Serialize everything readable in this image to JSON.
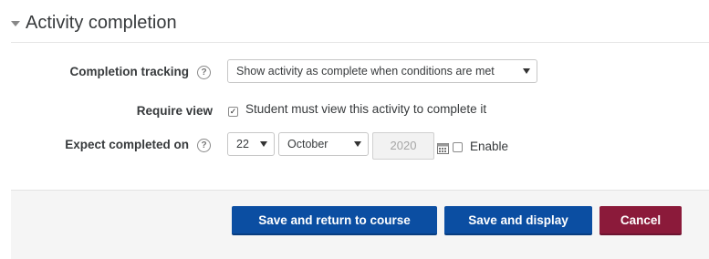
{
  "section": {
    "title": "Activity completion"
  },
  "fields": {
    "completion_tracking": {
      "label": "Completion tracking",
      "selected": "Show activity as complete when conditions are met"
    },
    "require_view": {
      "label": "Require view",
      "checkbox_label": "Student must view this activity to complete it",
      "checked": true
    },
    "expect_completed": {
      "label": "Expect completed on",
      "day": "22",
      "month": "October",
      "year": "2020",
      "enable_label": "Enable",
      "enable_checked": false
    }
  },
  "help_icon_glyph": "?",
  "checkmark_glyph": "✓",
  "buttons": {
    "save_return": "Save and return to course",
    "save_display": "Save and display",
    "cancel": "Cancel"
  },
  "colors": {
    "primary": "#0b4ea2",
    "danger": "#8b1a3a"
  }
}
